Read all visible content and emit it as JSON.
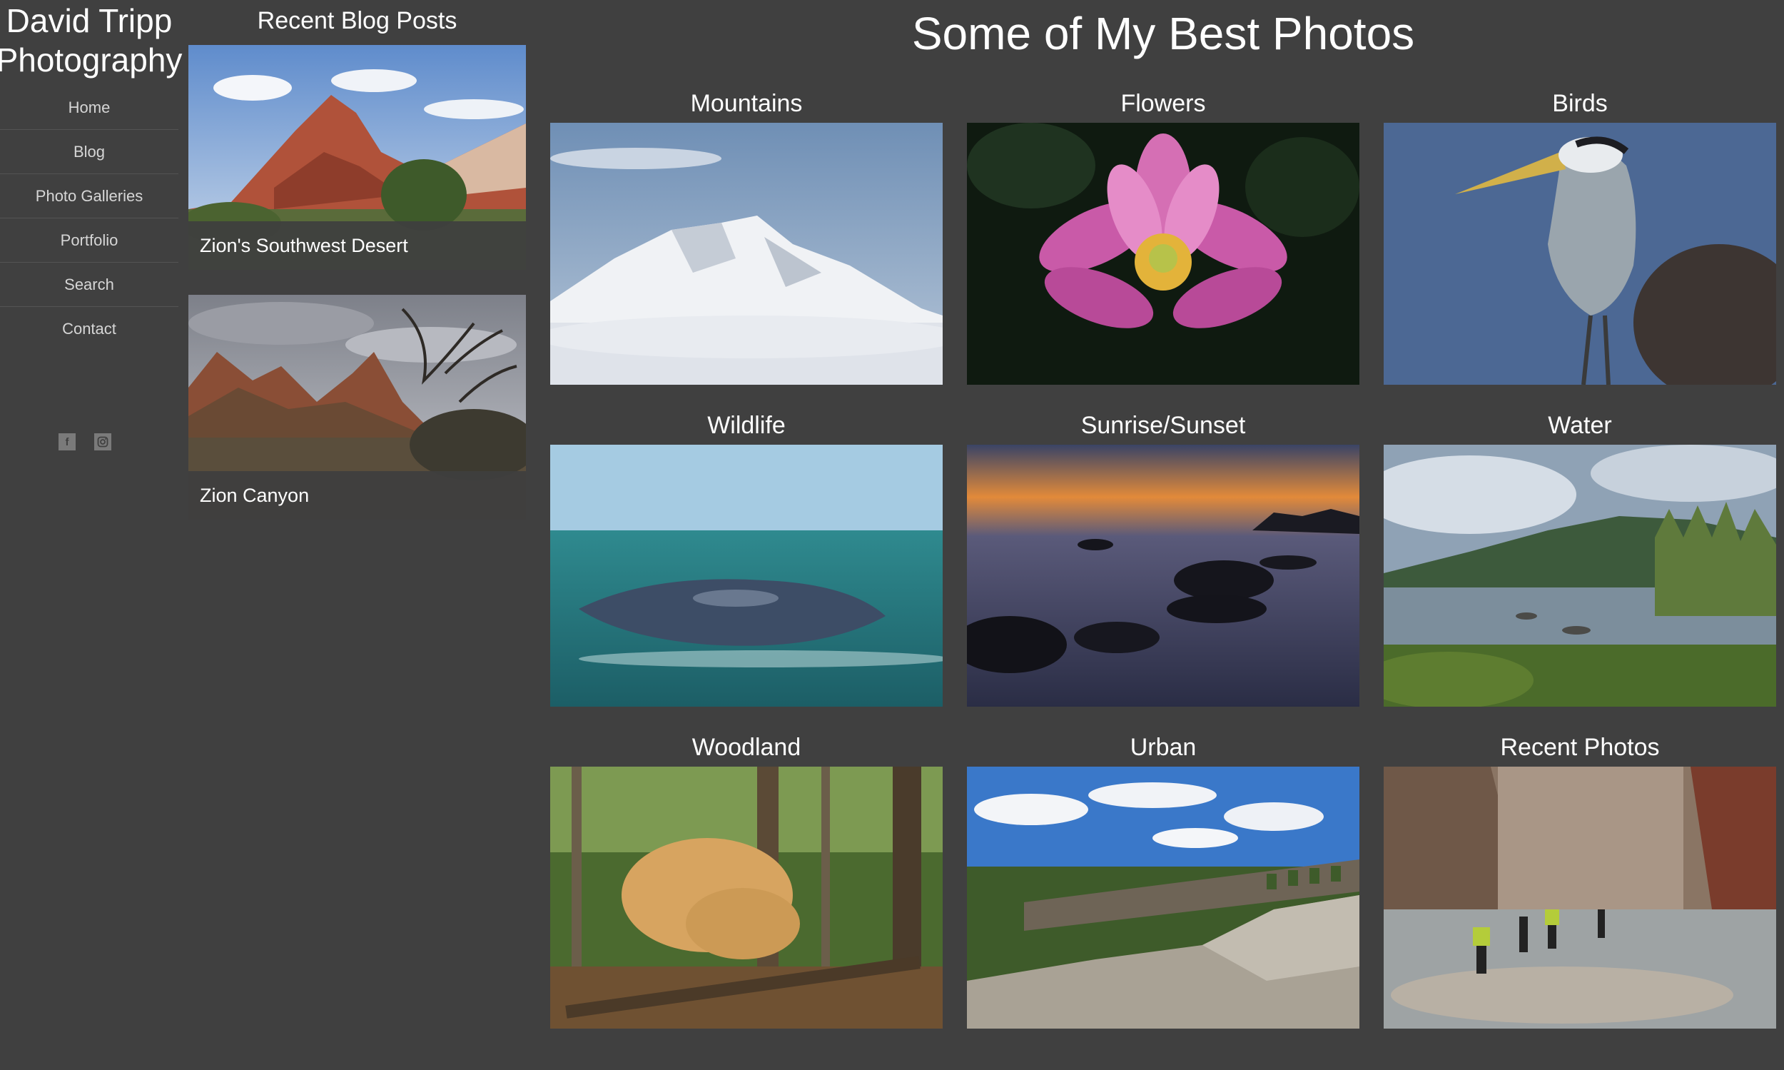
{
  "site": {
    "title_line1": "David Tripp",
    "title_line2": "Photography"
  },
  "nav": {
    "items": [
      {
        "label": "Home"
      },
      {
        "label": "Blog"
      },
      {
        "label": "Photo Galleries"
      },
      {
        "label": "Portfolio"
      },
      {
        "label": "Search"
      },
      {
        "label": "Contact"
      }
    ]
  },
  "social": {
    "icons": [
      "facebook-icon",
      "instagram-icon"
    ],
    "facebook_glyph": "f"
  },
  "blog": {
    "heading": "Recent Blog Posts",
    "posts": [
      {
        "title": "Zion's Southwest Desert"
      },
      {
        "title": "Zion Canyon"
      }
    ]
  },
  "gallery": {
    "title": "Some of My Best Photos",
    "items": [
      {
        "label": "Mountains"
      },
      {
        "label": "Flowers"
      },
      {
        "label": "Birds"
      },
      {
        "label": "Wildlife"
      },
      {
        "label": "Sunrise/Sunset"
      },
      {
        "label": "Water"
      },
      {
        "label": "Woodland"
      },
      {
        "label": "Urban"
      },
      {
        "label": "Recent Photos"
      }
    ]
  },
  "colors": {
    "background": "#404040",
    "nav_text": "#d6d6d6",
    "divider": "#545454"
  }
}
